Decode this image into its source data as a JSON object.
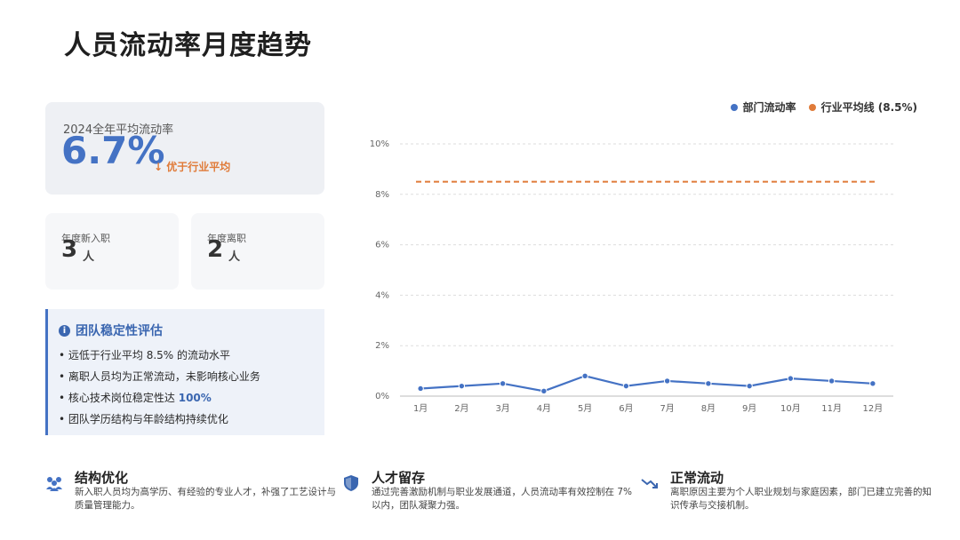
{
  "page": {
    "title": "人员流动率月度趋势"
  },
  "annual_card": {
    "label": "2024全年平均流动率",
    "value": "6.7%",
    "note": "↓ 优于行业平均"
  },
  "hires_card": {
    "label": "年度新入职",
    "value": "3",
    "unit": "人"
  },
  "leaves_card": {
    "label": "年度离职",
    "value": "2",
    "unit": "人"
  },
  "stability": {
    "title": "团队稳定性评估",
    "items": [
      {
        "pre": "• 远低于行业平均 8.5% 的流动水平",
        "hl": "",
        "post": ""
      },
      {
        "pre": "• 离职人员均为正常流动，未影响核心业务",
        "hl": "",
        "post": ""
      },
      {
        "pre": "• 核心技术岗位稳定性达 ",
        "hl": "100%",
        "post": ""
      },
      {
        "pre": "• 团队学历结构与年龄结构持续优化",
        "hl": "",
        "post": ""
      }
    ]
  },
  "legend": {
    "series": "部门流动率",
    "baseline": "行业平均线 (8.5%)"
  },
  "colors": {
    "accent": "#4472c4",
    "orange": "#e07b39"
  },
  "chart_data": {
    "type": "line",
    "categories": [
      "1月",
      "2月",
      "3月",
      "4月",
      "5月",
      "6月",
      "7月",
      "8月",
      "9月",
      "10月",
      "11月",
      "12月"
    ],
    "series": [
      {
        "name": "部门流动率",
        "values": [
          0.3,
          0.4,
          0.5,
          0.2,
          0.8,
          0.4,
          0.6,
          0.5,
          0.4,
          0.7,
          0.6,
          0.5
        ],
        "color": "#4472c4"
      },
      {
        "name": "行业平均线 (8.5%)",
        "values": [
          8.5,
          8.5,
          8.5,
          8.5,
          8.5,
          8.5,
          8.5,
          8.5,
          8.5,
          8.5,
          8.5,
          8.5
        ],
        "color": "#e07b39",
        "style": "dashed"
      }
    ],
    "yticks": [
      "0%",
      "2%",
      "4%",
      "6%",
      "8%",
      "10%"
    ],
    "ylim": [
      0,
      10
    ],
    "grid": true,
    "legend": "top-right"
  },
  "bottom": [
    {
      "icon": "people-icon",
      "title": "结构优化",
      "desc": "新入职人员均为高学历、有经验的专业人才，补强了工艺设计与质量管理能力。"
    },
    {
      "icon": "shield-icon",
      "title": "人才留存",
      "desc": "通过完善激励机制与职业发展通道，人员流动率有效控制在 7% 以内，团队凝聚力强。"
    },
    {
      "icon": "trend-down-icon",
      "title": "正常流动",
      "desc": "离职原因主要为个人职业规划与家庭因素，部门已建立完善的知识传承与交接机制。"
    }
  ]
}
